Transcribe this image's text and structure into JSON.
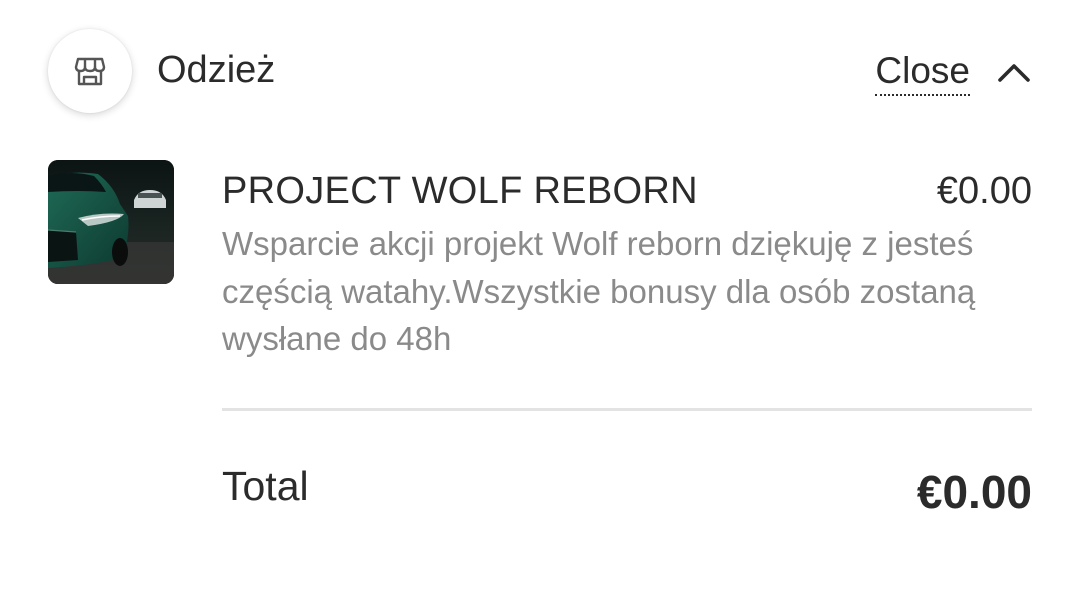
{
  "header": {
    "merchant_name": "Odzież",
    "store_icon": "storefront-icon",
    "close_label": "Close",
    "collapse_icon": "chevron-up-icon"
  },
  "item": {
    "title": "PROJECT WOLF REBORN",
    "price": "€0.00",
    "description": "Wsparcie akcji projekt Wolf reborn dziękuję z jesteś częścią watahy.Wszystkie bonusy dla osób zostaną wysłane do 48h",
    "thumbnail": "green-car-photo"
  },
  "summary": {
    "total_label": "Total",
    "total_value": "€0.00"
  }
}
